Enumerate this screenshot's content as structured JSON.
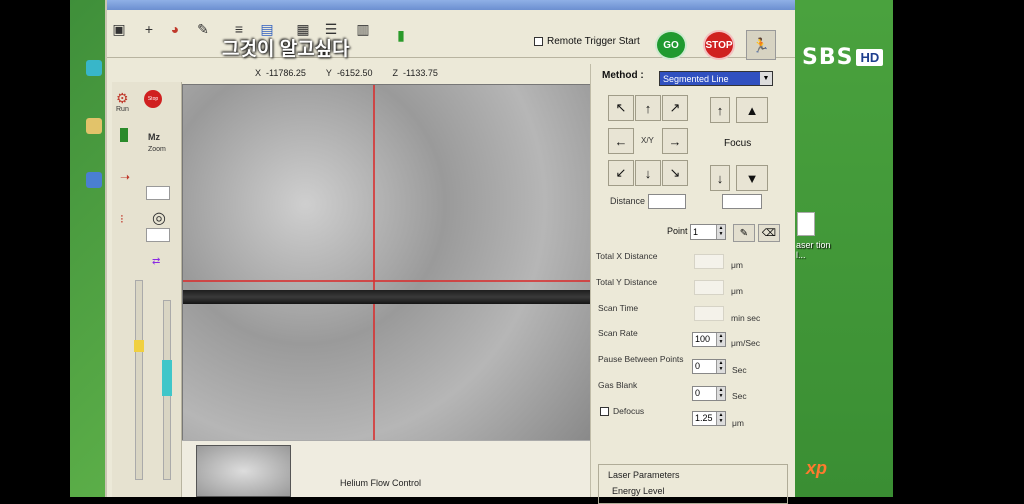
{
  "overlay": {
    "title": "그것이 알고싶다",
    "broadcaster": "SBS",
    "hd_badge": "HD"
  },
  "toolbar": {
    "remote_trigger_label": "Remote Trigger Start",
    "go_label": "GO",
    "stop_label": "STOP"
  },
  "coordinates": {
    "x_label": "X",
    "x_value": "-11786.25",
    "y_label": "Y",
    "y_value": "-6152.50",
    "z_label": "Z",
    "z_value": "-1133.75"
  },
  "left_panel": {
    "labels": [
      "Run",
      "Stop",
      "Mz",
      "Zoom"
    ]
  },
  "method": {
    "label": "Method :",
    "selected": "Segmented Line"
  },
  "navigation": {
    "xy_label": "X/Y",
    "focus_label": "Focus",
    "distance_label": "Distance"
  },
  "point": {
    "label": "Point",
    "value": "1"
  },
  "params": {
    "total_x": {
      "label": "Total X Distance",
      "unit": "μm"
    },
    "total_y": {
      "label": "Total Y Distance",
      "unit": "μm"
    },
    "scan_time": {
      "label": "Scan Time",
      "unit": "min sec"
    },
    "scan_rate": {
      "label": "Scan Rate",
      "value": "100",
      "unit": "μm/Sec"
    },
    "pause": {
      "label": "Pause Between Points",
      "value": "0",
      "unit": "Sec"
    },
    "gas_blank": {
      "label": "Gas Blank",
      "value": "0",
      "unit": "Sec"
    },
    "defocus": {
      "label": "Defocus",
      "value": "1.25",
      "unit": "μm"
    }
  },
  "laser": {
    "title": "Laser Parameters",
    "energy_label": "Energy Level"
  },
  "bottom": {
    "helium_label": "Helium Flow Control"
  },
  "desktop": {
    "icon_label": "aser tion l...",
    "os_badge": "xp"
  }
}
